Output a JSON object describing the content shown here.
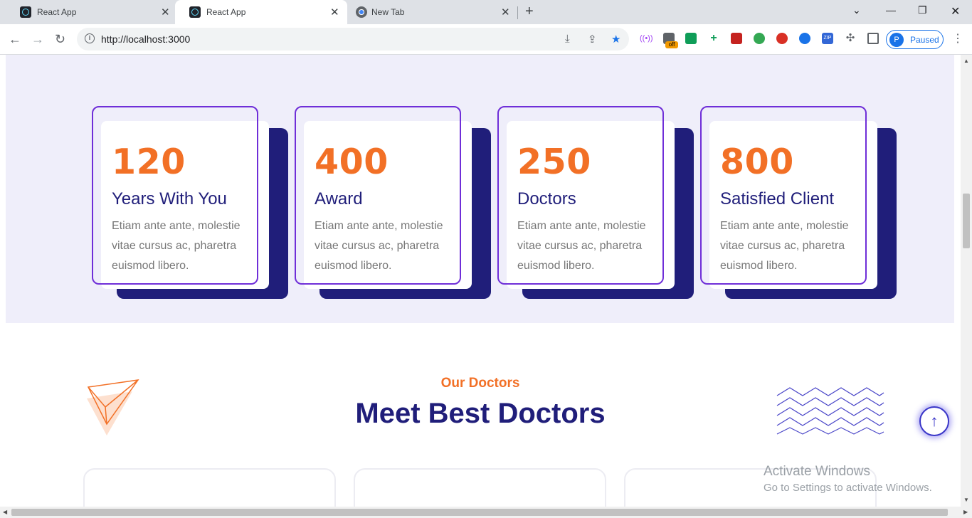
{
  "browser": {
    "tabs": [
      {
        "title": "React App"
      },
      {
        "title": "React App"
      },
      {
        "title": "New Tab"
      }
    ],
    "url": "http://localhost:3000",
    "profile_label": "Paused",
    "profile_initial": "P",
    "extension_badge": "off",
    "zip_label": "ZIP"
  },
  "stats": {
    "cards": [
      {
        "number": "120",
        "label": "Years With You",
        "desc": "Etiam ante ante, molestie vitae cursus ac, pharetra euismod libero."
      },
      {
        "number": "400",
        "label": "Award",
        "desc": "Etiam ante ante, molestie vitae cursus ac, pharetra euismod libero."
      },
      {
        "number": "250",
        "label": "Doctors",
        "desc": "Etiam ante ante, molestie vitae cursus ac, pharetra euismod libero."
      },
      {
        "number": "800",
        "label": "Satisfied Client",
        "desc": "Etiam ante ante, molestie vitae cursus ac, pharetra euismod libero."
      }
    ]
  },
  "doctors": {
    "subtitle": "Our Doctors",
    "title": "Meet Best Doctors"
  },
  "watermark": {
    "line1": "Activate Windows",
    "line2": "Go to Settings to activate Windows."
  },
  "colors": {
    "accent_orange": "#f27026",
    "navy": "#201e7a",
    "outline_purple": "#6f2ed8",
    "section_bg": "#efeefa"
  }
}
